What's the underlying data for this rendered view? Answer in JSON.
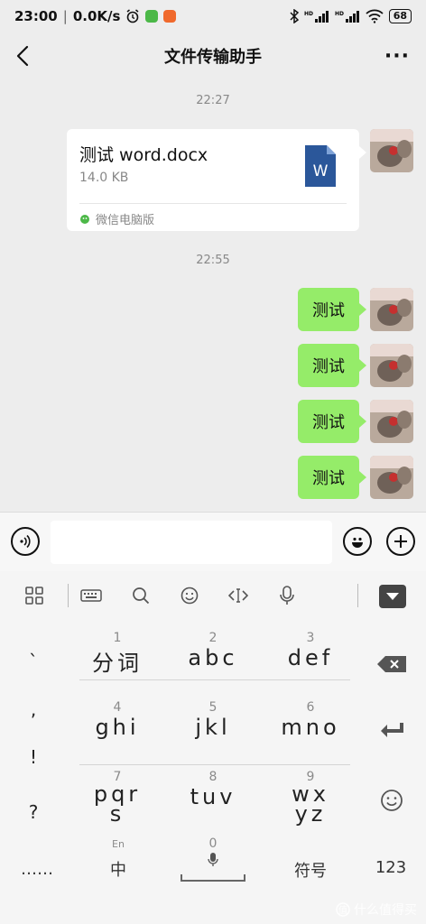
{
  "status_bar": {
    "time": "23:00",
    "net_speed": "0.0K/s",
    "battery": "68"
  },
  "header": {
    "title": "文件传输助手"
  },
  "chat": {
    "timestamp_1": "22:27",
    "file_message": {
      "file_name": "测试 word.docx",
      "file_size": "14.0 KB",
      "source": "微信电脑版",
      "doc_badge": "W"
    },
    "timestamp_2": "22:55",
    "text_messages": [
      "测试",
      "测试",
      "测试",
      "测试"
    ]
  },
  "keyboard": {
    "symbols": [
      "`",
      ",",
      "!",
      "?"
    ],
    "keys": [
      {
        "num": "1",
        "letters": "分词"
      },
      {
        "num": "2",
        "letters": "abc"
      },
      {
        "num": "3",
        "letters": "def"
      },
      {
        "num": "4",
        "letters": "ghi"
      },
      {
        "num": "5",
        "letters": "jkl"
      },
      {
        "num": "6",
        "letters": "mno"
      },
      {
        "num": "7",
        "letters": "pqrs"
      },
      {
        "num": "8",
        "letters": "tuv"
      },
      {
        "num": "9",
        "letters": "wxyz"
      }
    ],
    "ellipsis": "……",
    "lang_hint": "En",
    "lang_key": "中",
    "space_num": "0",
    "symbol_key": "符号",
    "number_key": "123"
  },
  "watermark": "什么值得买",
  "colors": {
    "chat_bg": "#ededed",
    "bubble_green": "#95ec69",
    "word_blue": "#2b579a"
  }
}
